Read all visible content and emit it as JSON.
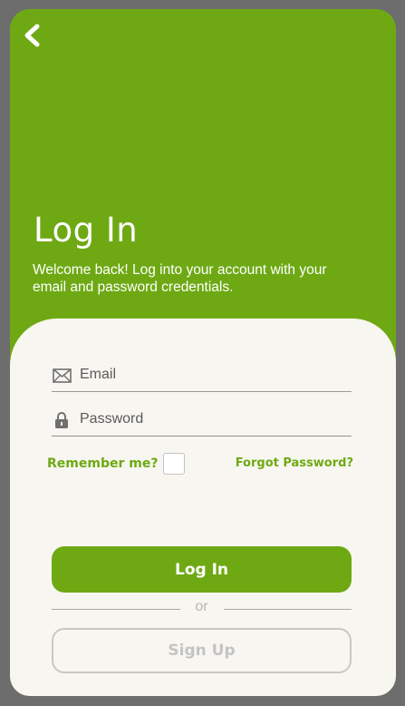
{
  "header": {
    "back_icon": "chevron-left-icon",
    "title": "Log In",
    "subtitle": "Welcome back! Log into your account with your email and password credentials."
  },
  "form": {
    "email": {
      "icon": "envelope-icon",
      "placeholder": "Email",
      "value": ""
    },
    "password": {
      "icon": "lock-icon",
      "placeholder": "Password",
      "value": ""
    },
    "remember_label": "Remember me?",
    "remember_checked": false,
    "forgot_label": "Forgot Password?"
  },
  "actions": {
    "login_label": "Log In",
    "or_label": "or",
    "signup_label": "Sign Up"
  },
  "colors": {
    "accent": "#6ea914",
    "card_background": "#f8f6f0",
    "frame": "#6d6d6d"
  }
}
